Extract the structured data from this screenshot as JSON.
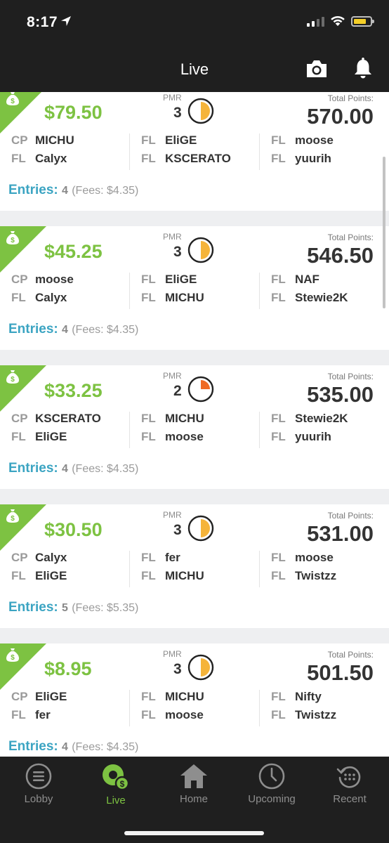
{
  "status_bar": {
    "time": "8:17"
  },
  "header": {
    "title": "Live"
  },
  "labels": {
    "pmr": "PMR",
    "total_points": "Total Points:",
    "entries": "Entries:"
  },
  "cards": [
    {
      "payout": "$79.50",
      "pmr": "3",
      "pmr_remaining": 0.5,
      "total_points": "570.00",
      "lineup": [
        {
          "pos": "CP",
          "player": "MICHU"
        },
        {
          "pos": "FL",
          "player": "Calyx"
        },
        {
          "pos": "FL",
          "player": "EliGE"
        },
        {
          "pos": "FL",
          "player": "KSCERATO"
        },
        {
          "pos": "FL",
          "player": "moose"
        },
        {
          "pos": "FL",
          "player": "yuurih"
        }
      ],
      "entries": "4",
      "fees": "(Fees: $4.35)"
    },
    {
      "payout": "$45.25",
      "pmr": "3",
      "pmr_remaining": 0.5,
      "total_points": "546.50",
      "lineup": [
        {
          "pos": "CP",
          "player": "moose"
        },
        {
          "pos": "FL",
          "player": "Calyx"
        },
        {
          "pos": "FL",
          "player": "EliGE"
        },
        {
          "pos": "FL",
          "player": "MICHU"
        },
        {
          "pos": "FL",
          "player": "NAF"
        },
        {
          "pos": "FL",
          "player": "Stewie2K"
        }
      ],
      "entries": "4",
      "fees": "(Fees: $4.35)"
    },
    {
      "payout": "$33.25",
      "pmr": "2",
      "pmr_remaining": 0.25,
      "total_points": "535.00",
      "lineup": [
        {
          "pos": "CP",
          "player": "KSCERATO"
        },
        {
          "pos": "FL",
          "player": "EliGE"
        },
        {
          "pos": "FL",
          "player": "MICHU"
        },
        {
          "pos": "FL",
          "player": "moose"
        },
        {
          "pos": "FL",
          "player": "Stewie2K"
        },
        {
          "pos": "FL",
          "player": "yuurih"
        }
      ],
      "entries": "4",
      "fees": "(Fees: $4.35)"
    },
    {
      "payout": "$30.50",
      "pmr": "3",
      "pmr_remaining": 0.5,
      "total_points": "531.00",
      "lineup": [
        {
          "pos": "CP",
          "player": "Calyx"
        },
        {
          "pos": "FL",
          "player": "EliGE"
        },
        {
          "pos": "FL",
          "player": "fer"
        },
        {
          "pos": "FL",
          "player": "MICHU"
        },
        {
          "pos": "FL",
          "player": "moose"
        },
        {
          "pos": "FL",
          "player": "Twistzz"
        }
      ],
      "entries": "5",
      "fees": "(Fees: $5.35)"
    },
    {
      "payout": "$8.95",
      "pmr": "3",
      "pmr_remaining": 0.5,
      "total_points": "501.50",
      "lineup": [
        {
          "pos": "CP",
          "player": "EliGE"
        },
        {
          "pos": "FL",
          "player": "fer"
        },
        {
          "pos": "FL",
          "player": "MICHU"
        },
        {
          "pos": "FL",
          "player": "moose"
        },
        {
          "pos": "FL",
          "player": "Nifty"
        },
        {
          "pos": "FL",
          "player": "Twistzz"
        }
      ],
      "entries": "4",
      "fees": "(Fees: $4.35)"
    }
  ],
  "tabs": [
    {
      "label": "Lobby",
      "icon": "menu-circle-icon",
      "active": false
    },
    {
      "label": "Live",
      "icon": "live-money-icon",
      "active": true
    },
    {
      "label": "Home",
      "icon": "home-icon",
      "active": false
    },
    {
      "label": "Upcoming",
      "icon": "clock-icon",
      "active": false
    },
    {
      "label": "Recent",
      "icon": "history-icon",
      "active": false
    }
  ],
  "colors": {
    "accent_green": "#7dc242",
    "entries_blue": "#3ba4c2",
    "pmr_orange": "#f5b43a",
    "pmr_orange_low": "#ef6a23",
    "bar_dark": "#1f1f1f"
  }
}
